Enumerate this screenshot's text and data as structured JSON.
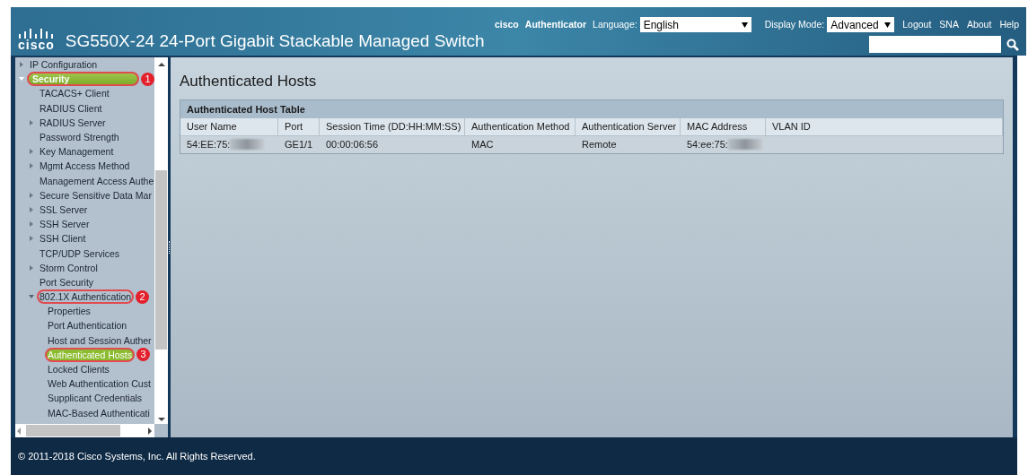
{
  "header": {
    "logo": "cisco",
    "title": "SG550X-24 24-Port Gigabit Stackable Managed Switch",
    "user": "cisco",
    "role": "Authenticator",
    "language_label": "Language:",
    "language": "English",
    "display_mode_label": "Display Mode:",
    "display_mode": "Advanced",
    "links": [
      "Logout",
      "SNA",
      "About",
      "Help"
    ]
  },
  "sidebar": {
    "items": [
      {
        "label": "IP Configuration",
        "kind": "folder",
        "expanded": false,
        "selected": false
      },
      {
        "label": "Security",
        "kind": "folder",
        "expanded": true,
        "selected": true,
        "callout": "1",
        "children": [
          {
            "label": "TACACS+ Client",
            "kind": "page",
            "selected": false
          },
          {
            "label": "RADIUS Client",
            "kind": "page",
            "selected": false
          },
          {
            "label": "RADIUS Server",
            "kind": "folder",
            "expanded": false,
            "selected": false
          },
          {
            "label": "Password Strength",
            "kind": "page",
            "selected": false
          },
          {
            "label": "Key Management",
            "kind": "folder",
            "expanded": false,
            "selected": false
          },
          {
            "label": "Mgmt Access Method",
            "kind": "folder",
            "expanded": false,
            "selected": false
          },
          {
            "label": "Management Access Authe",
            "kind": "page",
            "selected": false
          },
          {
            "label": "Secure Sensitive Data Mar",
            "kind": "folder",
            "expanded": false,
            "selected": false
          },
          {
            "label": "SSL Server",
            "kind": "folder",
            "expanded": false,
            "selected": false
          },
          {
            "label": "SSH Server",
            "kind": "folder",
            "expanded": false,
            "selected": false
          },
          {
            "label": "SSH Client",
            "kind": "folder",
            "expanded": false,
            "selected": false
          },
          {
            "label": "TCP/UDP Services",
            "kind": "page",
            "selected": false
          },
          {
            "label": "Storm Control",
            "kind": "folder",
            "expanded": false,
            "selected": false
          },
          {
            "label": "Port Security",
            "kind": "page",
            "selected": false
          },
          {
            "label": "802.1X Authentication",
            "kind": "folder",
            "expanded": true,
            "selected": false,
            "callout": "2",
            "children": [
              {
                "label": "Properties",
                "kind": "page",
                "selected": false
              },
              {
                "label": "Port Authentication",
                "kind": "page",
                "selected": false
              },
              {
                "label": "Host and Session Auther",
                "kind": "page",
                "selected": false
              },
              {
                "label": "Authenticated Hosts",
                "kind": "page",
                "selected": true,
                "callout": "3"
              },
              {
                "label": "Locked Clients",
                "kind": "page",
                "selected": false
              },
              {
                "label": "Web Authentication Cust",
                "kind": "page",
                "selected": false
              },
              {
                "label": "Supplicant Credentials",
                "kind": "page",
                "selected": false
              },
              {
                "label": "MAC-Based Authenticati",
                "kind": "page",
                "selected": false
              }
            ]
          }
        ]
      }
    ]
  },
  "page": {
    "title": "Authenticated Hosts",
    "table": {
      "title": "Authenticated Host Table",
      "columns": [
        "User Name",
        "Port",
        "Session Time (DD:HH:MM:SS)",
        "Authentication Method",
        "Authentication Server",
        "MAC Address",
        "VLAN ID"
      ],
      "rows": [
        [
          {
            "text": "54:EE:75:",
            "redacted": true
          },
          {
            "text": "GE1/1",
            "redacted": false
          },
          {
            "text": "00:00:06:56",
            "redacted": false
          },
          {
            "text": "MAC",
            "redacted": false
          },
          {
            "text": "Remote",
            "redacted": false
          },
          {
            "text": "54:ee:75:",
            "redacted": true
          }
        ]
      ]
    }
  },
  "footer": "© 2011-2018 Cisco Systems, Inc. All Rights Reserved."
}
